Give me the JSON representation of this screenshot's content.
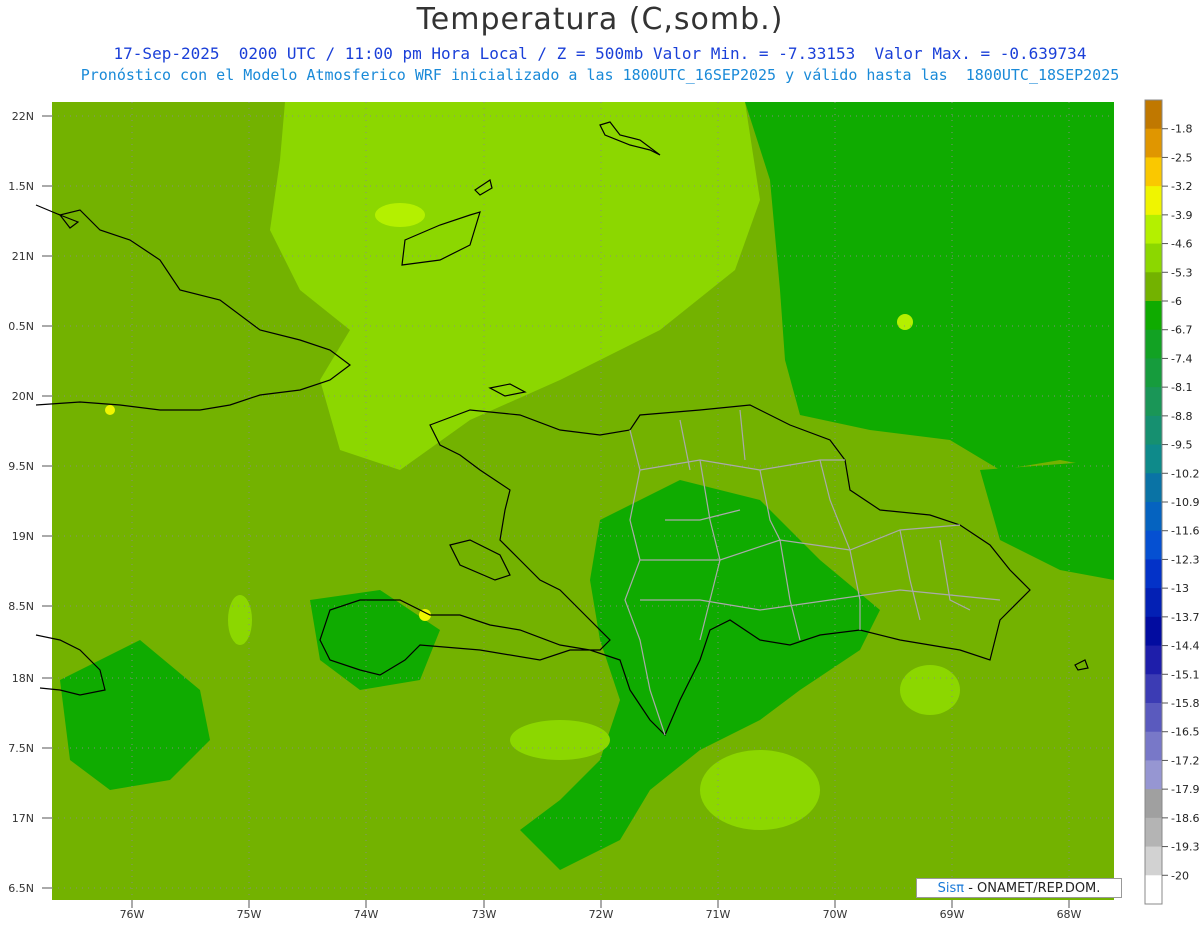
{
  "header": {
    "title": "Temperatura (C,somb.)",
    "subtitle1": "17-Sep-2025  0200 UTC / 11:00 pm Hora Local / Z = 500mb Valor Min. = -7.33153  Valor Max. = -0.639734",
    "subtitle2": "Pronóstico con el Modelo Atmosferico WRF inicializado a las 1800UTC_16SEP2025 y válido hasta las  1800UTC_18SEP2025"
  },
  "map": {
    "lat_labels": [
      "22N",
      "1.5N",
      "21N",
      "0.5N",
      "20N",
      "9.5N",
      "19N",
      "8.5N",
      "18N",
      "7.5N",
      "17N",
      "6.5N"
    ],
    "lon_labels": [
      "76W",
      "75W",
      "74W",
      "73W",
      "72W",
      "71W",
      "70W",
      "69W",
      "68W"
    ],
    "background_color": "#73b200"
  },
  "legend": {
    "labels": [
      "-1.8",
      "-2.5",
      "-3.2",
      "-3.9",
      "-4.6",
      "-5.3",
      "-6",
      "-6.7",
      "-7.4",
      "-8.1",
      "-8.8",
      "-9.5",
      "-10.2",
      "-10.9",
      "-11.6",
      "-12.3",
      "-13",
      "-13.7",
      "-14.4",
      "-15.1",
      "-15.8",
      "-16.5",
      "-17.2",
      "-17.9",
      "-18.6",
      "-19.3",
      "-20"
    ],
    "colors": [
      "#c07800",
      "#e09600",
      "#fac800",
      "#f0f500",
      "#b4f000",
      "#8cd700",
      "#73b200",
      "#0fab00",
      "#12a223",
      "#169c3d",
      "#1a9657",
      "#169070",
      "#0e8a8a",
      "#0a73a5",
      "#0563c0",
      "#0550d2",
      "#0332c8",
      "#0320b4",
      "#020ca0",
      "#1e1eaa",
      "#3c3cb4",
      "#5a5abe",
      "#7878c8",
      "#9696d2",
      "#a0a0a0",
      "#b4b4b4",
      "#d2d2d2",
      "#ffffff"
    ]
  },
  "credit": {
    "brand": "Sisπ",
    "text": " - ONAMET/REP.DOM."
  }
}
